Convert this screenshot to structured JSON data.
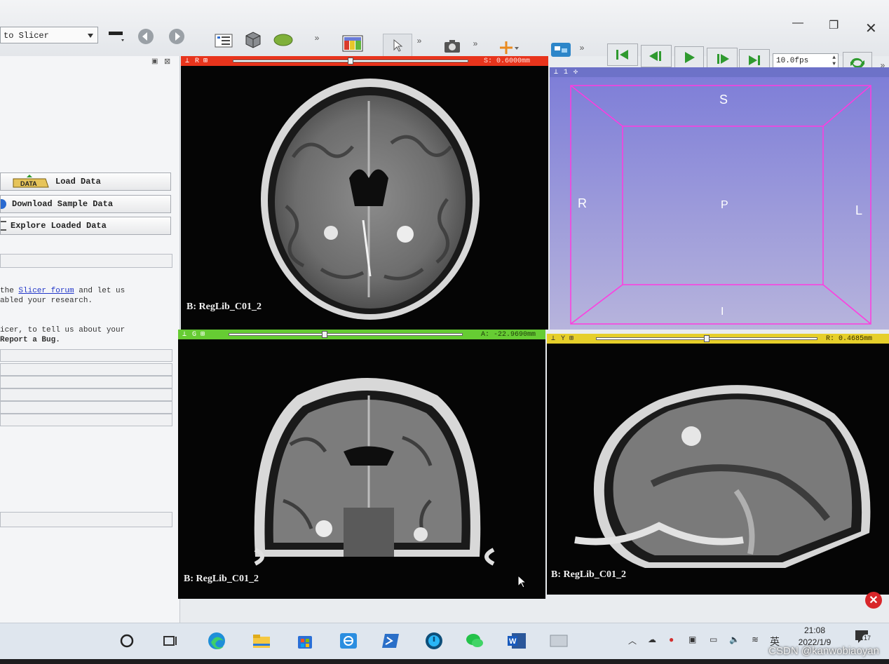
{
  "toolbar": {
    "module_select": "to Slicer",
    "fps": "10.0fps"
  },
  "left_panel": {
    "load_data": "Load Data",
    "download_sample": "Download Sample Data",
    "explore_loaded": "Explore Loaded Data",
    "help_line1_pre": "the ",
    "help_line1_link": "Slicer forum",
    "help_line1_post": " and let us",
    "help_line2": "abled your research.",
    "help_line3": "icer, to tell us about your",
    "help_line4": " Report a Bug."
  },
  "views": {
    "red": {
      "letter": "R",
      "offset": "S: 0.6000mm",
      "label": "B: RegLib_C01_2",
      "color": "#e8341c",
      "slider_fraction": 0.5
    },
    "three_d": {
      "index": "1",
      "orient_s": "S",
      "orient_r": "R",
      "orient_p": "P",
      "orient_l": "L",
      "orient_i": "I",
      "box_color": "#ff3be0"
    },
    "green": {
      "letter": "G",
      "offset": "A: -22.9690mm",
      "label": "B: RegLib_C01_2",
      "color": "#66cc33",
      "slider_fraction": 0.41
    },
    "yellow": {
      "letter": "Y",
      "offset": "R: 0.4685mm",
      "label": "B: RegLib_C01_2",
      "color": "#e6cf2a",
      "slider_fraction": 0.5
    }
  },
  "taskbar": {
    "ime": "英",
    "time": "21:08",
    "date": "2022/1/9",
    "notifications": "17"
  },
  "watermark": "CSDN @kanwobiaoyan"
}
